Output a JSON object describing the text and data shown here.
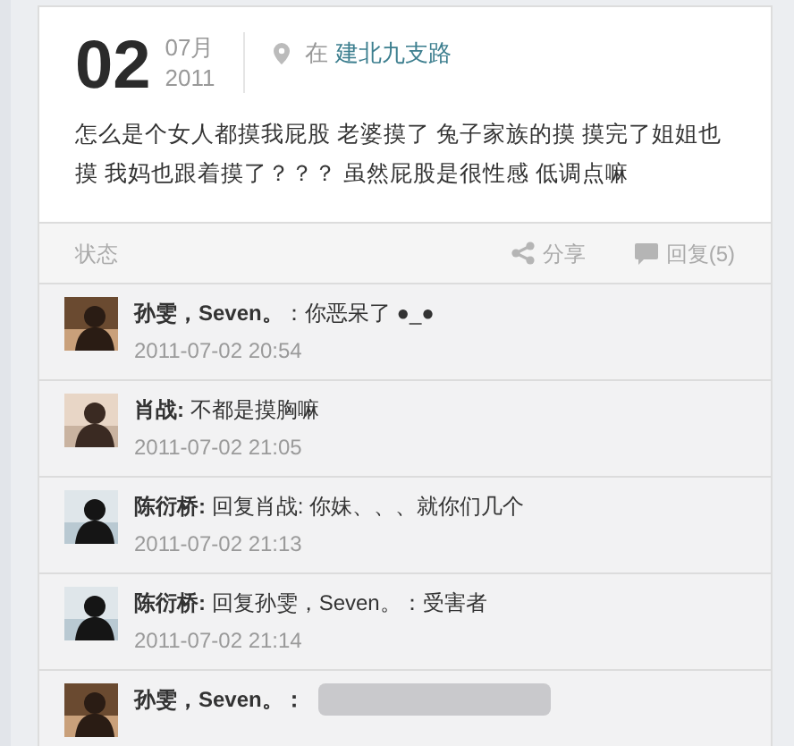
{
  "post": {
    "day": "02",
    "month": "07月",
    "year": "2011",
    "location_prefix": "在",
    "location": "建北九支路",
    "text": "怎么是个女人都摸我屁股 老婆摸了 兔子家族的摸 摸完了姐姐也摸 我妈也跟着摸了？？？  虽然屁股是很性感 低调点嘛"
  },
  "footer": {
    "type_label": "状态",
    "share": "分享",
    "reply": "回复(5)"
  },
  "comments": [
    {
      "author": "孙雯，Seven。",
      "text": "：你恶呆了 ●_●",
      "time": "2011-07-02 20:54"
    },
    {
      "author": "肖战:",
      "text": " 不都是摸胸嘛",
      "time": "2011-07-02 21:05"
    },
    {
      "author": "陈衍桥:",
      "text": " 回复肖战: 你妹、、、就你们几个",
      "time": "2011-07-02 21:13"
    },
    {
      "author": "陈衍桥:",
      "text": " 回复孙雯，Seven。：受害者",
      "time": "2011-07-02 21:14"
    },
    {
      "author": "孙雯，Seven。：",
      "redacted": true
    }
  ]
}
